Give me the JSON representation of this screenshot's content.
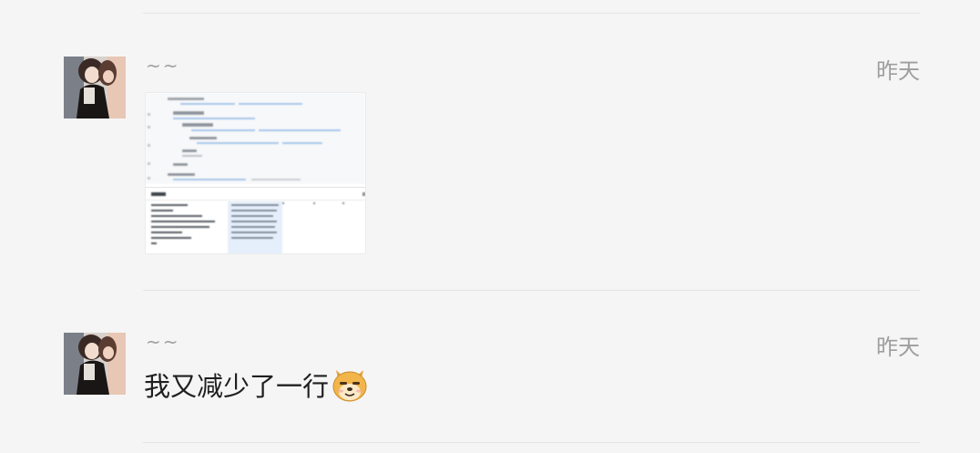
{
  "messages": [
    {
      "sender": "~~",
      "time": "昨天",
      "type": "image",
      "avatar_icon": "girl-portrait-avatar",
      "image_icon": "blurred-table-screenshot"
    },
    {
      "sender": "~~",
      "time": "昨天",
      "type": "text",
      "text": "我又减少了一行",
      "avatar_icon": "girl-portrait-avatar",
      "emoji_icon": "doge-emoji-icon"
    }
  ],
  "colors": {
    "background": "#f5f5f5",
    "divider": "#e4e4e4",
    "meta_text": "#9e9e9e",
    "message_text": "#1f1f1f"
  }
}
